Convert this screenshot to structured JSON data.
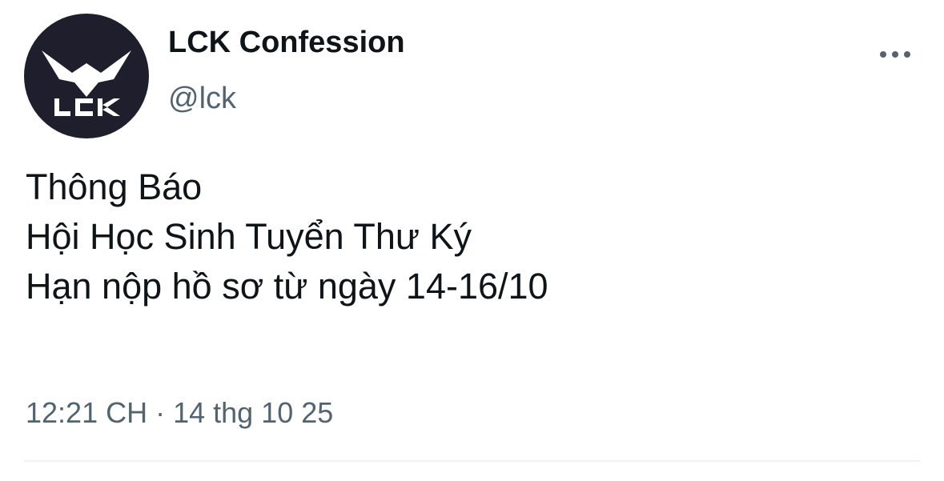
{
  "author": {
    "display_name": "LCK Confession",
    "handle": "@lck",
    "avatar_logo_text": "LCK"
  },
  "more_icon": "more-horizontal-icon",
  "tweet": {
    "lines": [
      "Thông Báo",
      "Hội Học Sinh Tuyển Thư Ký",
      "Hạn nộp hồ sơ từ ngày 14-16/10"
    ]
  },
  "meta": {
    "time": "12:21 CH",
    "separator": "·",
    "date": "14 thg 10 25"
  },
  "colors": {
    "text_primary": "#0f1419",
    "text_secondary": "#536471",
    "avatar_bg": "#1e1e2c",
    "divider": "#eff3f4"
  }
}
